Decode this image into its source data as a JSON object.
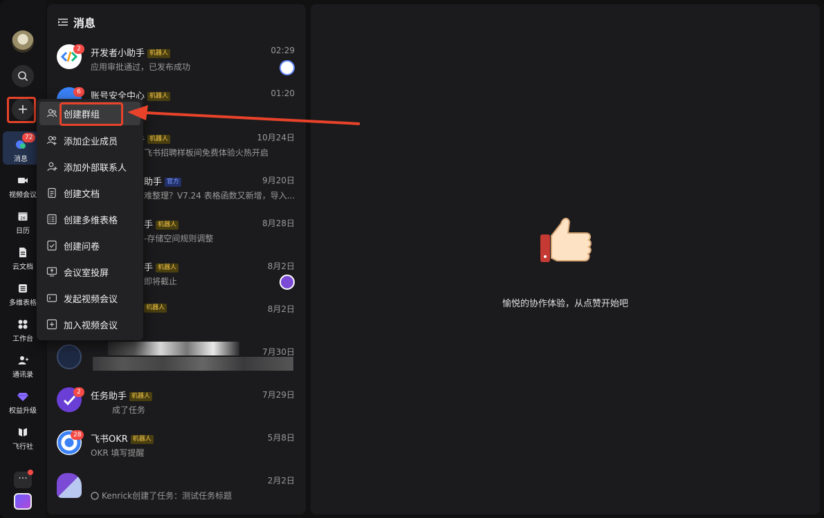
{
  "rail": {
    "items": [
      {
        "label": "消息",
        "badge": "72"
      },
      {
        "label": "视频会议"
      },
      {
        "label": "日历",
        "icon_text": "26"
      },
      {
        "label": "云文档"
      },
      {
        "label": "多维表格"
      },
      {
        "label": "工作台"
      },
      {
        "label": "通讯录"
      },
      {
        "label": "权益升级"
      },
      {
        "label": "飞行社"
      }
    ],
    "more_label": "···"
  },
  "list": {
    "title": "消息",
    "chats": [
      {
        "name": "开发者小助手",
        "tag": "机器人",
        "preview": "应用审批通过，已发布成功",
        "time": "02:29",
        "badge": "2"
      },
      {
        "name": "账号安全中心",
        "tag": "机器人",
        "preview": "",
        "time": "01:20",
        "badge": "6"
      },
      {
        "name": "手",
        "tag": "机器人",
        "preview": "飞书招聘样板间免费体验火热开启",
        "time": "10月24日"
      },
      {
        "name": "助手",
        "tag": "官方",
        "preview": "难整理？V7.24 表格函数又新增，导入...",
        "time": "9月20日"
      },
      {
        "name": "手",
        "tag": "机器人",
        "preview": "-存储空间规则调整",
        "time": "8月28日"
      },
      {
        "name": "手",
        "tag": "机器人",
        "preview": "即将截止",
        "time": "8月2日"
      },
      {
        "name": "",
        "tag": "机器人",
        "preview": "",
        "time": "8月2日"
      },
      {
        "name": "",
        "tag": "",
        "preview": "",
        "time": "7月30日"
      },
      {
        "name": "任务助手",
        "tag": "机器人",
        "preview": "成了任务",
        "time": "7月29日",
        "badge": "2"
      },
      {
        "name": "飞书OKR",
        "tag": "机器人",
        "preview": "OKR 填写提醒",
        "time": "5月8日",
        "badge": "28"
      },
      {
        "name": "",
        "tag": "",
        "preview": "Kenrick创建了任务：测试任务标题",
        "time": "2月2日"
      }
    ]
  },
  "menu": {
    "items": [
      "创建群组",
      "添加企业成员",
      "添加外部联系人",
      "创建文档",
      "创建多维表格",
      "创建问卷",
      "会议室投屏",
      "发起视频会议",
      "加入视频会议"
    ]
  },
  "main": {
    "empty_text": "愉悦的协作体验，从点赞开始吧"
  },
  "colors": {
    "highlight": "#e8432a",
    "badge": "#f54a45",
    "bot_tag": "#f3c64a",
    "official_tag": "#7f9cff"
  }
}
